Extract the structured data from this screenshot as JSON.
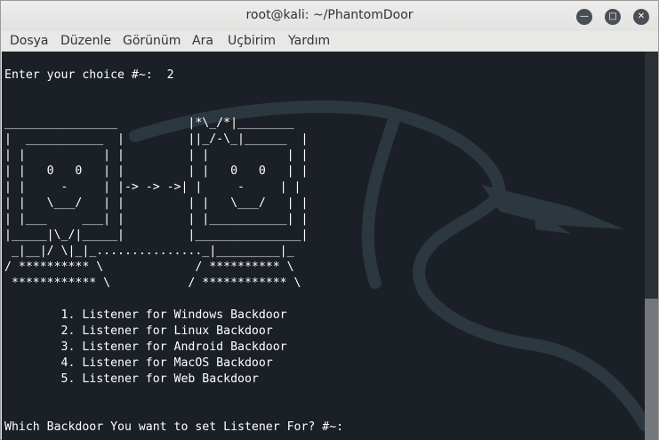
{
  "window": {
    "title": "root@kali: ~/PhantomDoor"
  },
  "menu": {
    "items": [
      "Dosya",
      "Düzenle",
      "Görünüm",
      "Ara",
      "Uçbirim",
      "Yardım"
    ]
  },
  "terminal": {
    "lines": [
      "",
      "Enter your choice #~:  2",
      "",
      "",
      "________________          |*\\_/*|________",
      "|  ___________  |         ||_/-\\_|______  |",
      "| |           | |         | |           | |",
      "| |   0   0   | |         | |   0   0   | |",
      "| |     -     | |-> -> ->| |     -     | |",
      "| |   \\___/   | |         | |   \\___/   | |",
      "| |___     ___| |         | |___________| |",
      "|_____|\\_/|_____|         |_______________|",
      " _|__|/ \\|_|_..............._|_________|_",
      "/ ********** \\             / ********** \\",
      " ************ \\           / ************ \\",
      "",
      "        1. Listener for Windows Backdoor",
      "        2. Listener for Linux Backdoor",
      "        3. Listener for Android Backdoor",
      "        4. Listener for MacOS Backdoor",
      "        5. Listener for Web Backdoor",
      "",
      "",
      "Which Backdoor You want to set Listener For? #~:"
    ]
  },
  "icons": {
    "minimize": "minimize-icon",
    "maximize": "maximize-icon",
    "close": "close-icon"
  }
}
